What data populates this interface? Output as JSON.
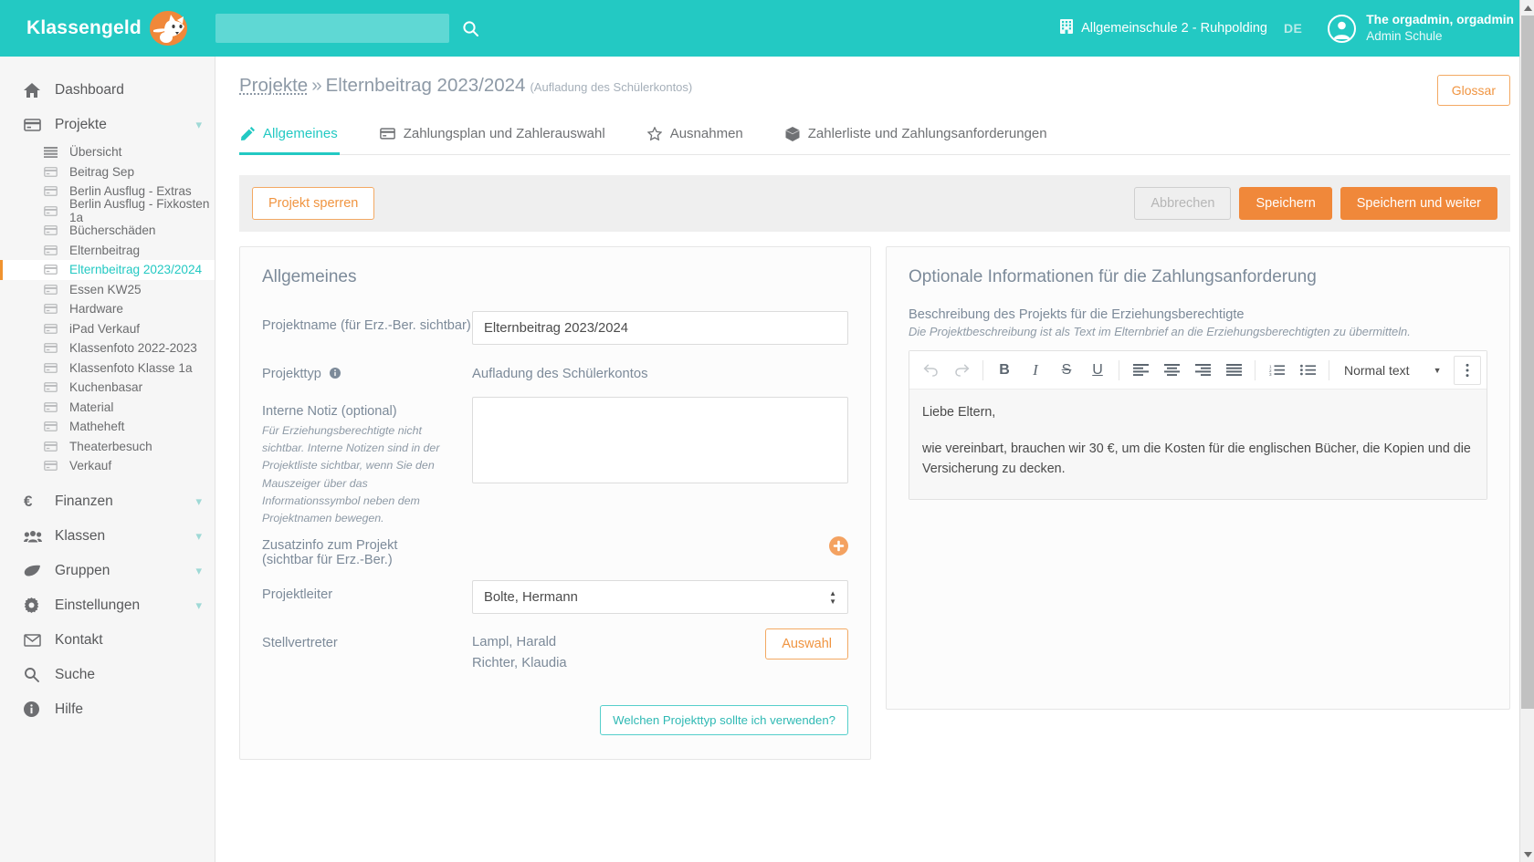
{
  "brand": {
    "name": "Klassengeld",
    "logo_icon": "fox-logo-icon",
    "accent": "#23c9c3",
    "orange": "#f0883a"
  },
  "search": {
    "value": "",
    "placeholder": "",
    "icon": "search-icon"
  },
  "header": {
    "school_icon": "building-icon",
    "school": "Allgemeinschule 2 - Ruhpolding",
    "language": "DE",
    "user_icon": "user-avatar-icon",
    "user_name": "The orgadmin, orgadmin",
    "user_role": "Admin Schule"
  },
  "sidebar": {
    "items": [
      {
        "label": "Dashboard",
        "icon": "home-icon",
        "expandable": false
      },
      {
        "label": "Projekte",
        "icon": "card-icon",
        "expandable": true
      }
    ],
    "projects": [
      {
        "label": "Übersicht",
        "icon": "list-icon",
        "active": false
      },
      {
        "label": "Beitrag Sep",
        "icon": "card-icon",
        "active": false
      },
      {
        "label": "Berlin Ausflug - Extras",
        "icon": "card-icon",
        "active": false
      },
      {
        "label": "Berlin Ausflug - Fixkosten 1a",
        "icon": "card-icon",
        "active": false
      },
      {
        "label": "Bücherschäden",
        "icon": "card-icon",
        "active": false
      },
      {
        "label": "Elternbeitrag",
        "icon": "card-icon",
        "active": false
      },
      {
        "label": "Elternbeitrag 2023/2024",
        "icon": "card-icon",
        "active": true
      },
      {
        "label": "Essen KW25",
        "icon": "card-icon",
        "active": false
      },
      {
        "label": "Hardware",
        "icon": "card-icon",
        "active": false
      },
      {
        "label": "iPad Verkauf",
        "icon": "card-icon",
        "active": false
      },
      {
        "label": "Klassenfoto 2022-2023",
        "icon": "card-icon",
        "active": false
      },
      {
        "label": "Klassenfoto Klasse 1a",
        "icon": "card-icon",
        "active": false
      },
      {
        "label": "Kuchenbasar",
        "icon": "card-icon",
        "active": false
      },
      {
        "label": "Material",
        "icon": "card-icon",
        "active": false
      },
      {
        "label": "Matheheft",
        "icon": "card-icon",
        "active": false
      },
      {
        "label": "Theaterbesuch",
        "icon": "card-icon",
        "active": false
      },
      {
        "label": "Verkauf",
        "icon": "card-icon",
        "active": false
      }
    ],
    "items_bottom": [
      {
        "label": "Finanzen",
        "icon": "euro-icon",
        "expandable": true
      },
      {
        "label": "Klassen",
        "icon": "people-icon",
        "expandable": true
      },
      {
        "label": "Gruppen",
        "icon": "leaf-icon",
        "expandable": true
      },
      {
        "label": "Einstellungen",
        "icon": "gear-icon",
        "expandable": true
      },
      {
        "label": "Kontakt",
        "icon": "envelope-icon",
        "expandable": false
      },
      {
        "label": "Suche",
        "icon": "search-icon",
        "expandable": false
      },
      {
        "label": "Hilfe",
        "icon": "info-icon",
        "expandable": false
      }
    ]
  },
  "breadcrumb": {
    "parent": "Projekte",
    "separator": "»",
    "current": "Elternbeitrag 2023/2024",
    "subtitle": "(Aufladung des Schülerkontos)"
  },
  "glossar_button": "Glossar",
  "tabs": [
    {
      "label": "Allgemeines",
      "icon": "pencil-icon",
      "active": true
    },
    {
      "label": "Zahlungsplan und Zahlerauswahl",
      "icon": "card-icon",
      "active": false
    },
    {
      "label": "Ausnahmen",
      "icon": "star-icon",
      "active": false
    },
    {
      "label": "Zahlerliste und Zahlungsanforderungen",
      "icon": "box-icon",
      "active": false
    }
  ],
  "actionbar": {
    "lock_project": "Projekt sperren",
    "cancel": "Abbrechen",
    "save": "Speichern",
    "save_continue": "Speichern und weiter"
  },
  "left_panel": {
    "title": "Allgemeines",
    "project_name": {
      "label": "Projektname (für Erz.-Ber. sichtbar)",
      "value": "Elternbeitrag 2023/2024"
    },
    "project_type": {
      "label": "Projekttyp",
      "info_icon": "info-circle-icon",
      "value": "Aufladung des Schülerkontos"
    },
    "internal_note": {
      "label": "Interne Notiz (optional)",
      "hint": "Für Erziehungsberechtigte nicht sichtbar. Interne Notizen sind in der Projektliste sichtbar, wenn Sie den Mauszeiger über das Informationssymbol neben dem Projektnamen bewegen.",
      "value": "",
      "placeholder": ""
    },
    "extra_info": {
      "label_line1": "Zusatzinfo zum Projekt",
      "label_line2": "(sichtbar für Erz.-Ber.)",
      "add_icon": "plus-circle-icon"
    },
    "project_lead": {
      "label": "Projektleiter",
      "value": "Bolte, Hermann"
    },
    "deputies": {
      "label": "Stellvertreter",
      "values": [
        "Lampl, Harald",
        "Richter, Klaudia"
      ],
      "button": "Auswahl"
    },
    "help_button": "Welchen Projekttyp sollte ich verwenden?"
  },
  "right_panel": {
    "title": "Optionale Informationen für die Zahlungsanforderung",
    "description_label": "Beschreibung des Projekts für die Erziehungsberechtigte",
    "description_note": "Die Projektbeschreibung ist als Text im Elternbrief an die Erziehungsberechtigten zu übermitteln.",
    "editor": {
      "toolbar": {
        "undo": "undo-icon",
        "redo": "redo-icon",
        "bold": "B",
        "italic": "I",
        "strike": "S",
        "underline": "U",
        "align_left": "align-left-icon",
        "align_center": "align-center-icon",
        "align_right": "align-right-icon",
        "align_justify": "align-justify-icon",
        "ordered_list": "ordered-list-icon",
        "bullet_list": "bullet-list-icon",
        "style_select": "Normal text",
        "more": "kebab-menu-icon"
      },
      "paragraphs": [
        "Liebe Eltern,",
        "wie vereinbart, brauchen wir 30 €, um die Kosten für die englischen Bücher, die Kopien und die Versicherung zu decken."
      ]
    }
  },
  "scrollbar": {
    "up_icon": "scroll-up-icon",
    "down_icon": "scroll-down-icon"
  }
}
